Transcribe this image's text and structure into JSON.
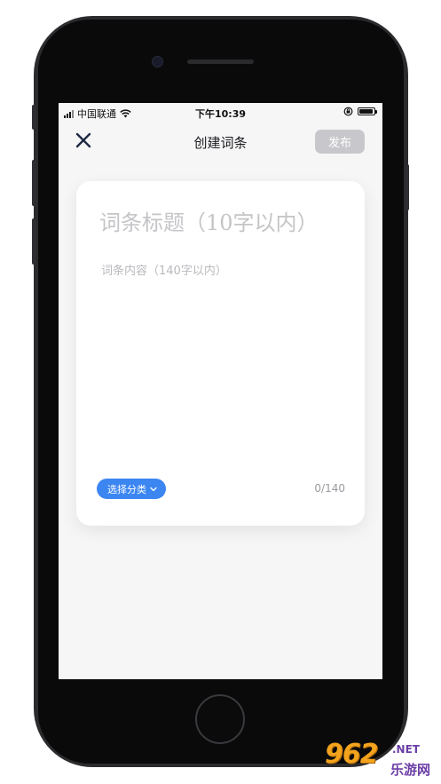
{
  "status_bar": {
    "carrier": "中国联通",
    "time": "下午10:39"
  },
  "nav": {
    "title": "创建词条",
    "publish_label": "发布"
  },
  "editor": {
    "title_placeholder": "词条标题（10字以内）",
    "content_placeholder": "词条内容（140字以内）",
    "category_label": "选择分类",
    "char_count": "0/140"
  },
  "watermark": {
    "main": "962",
    "net": ".NET",
    "sub": "乐游网"
  },
  "colors": {
    "accent": "#3c86f2",
    "publish_disabled": "#c8c8cc",
    "screen_bg": "#f6f6f7"
  }
}
